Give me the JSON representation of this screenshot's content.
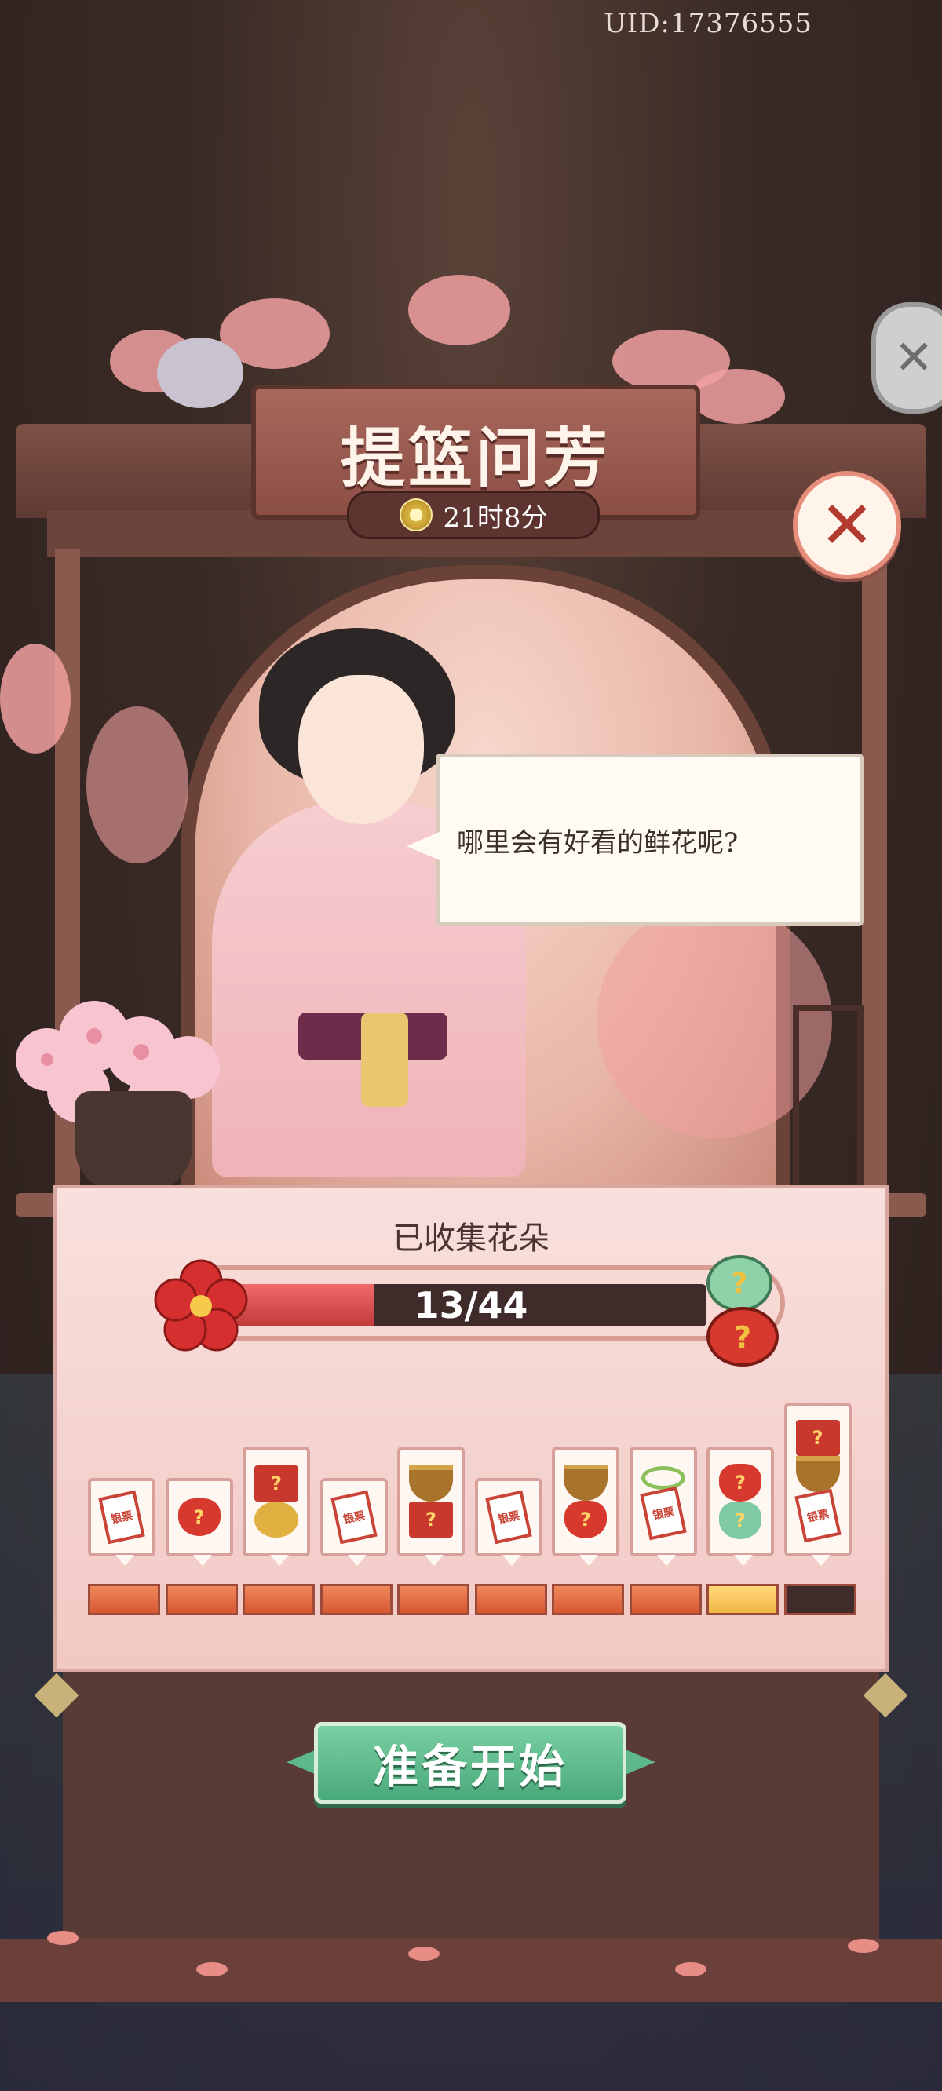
{
  "header": {
    "uid": "UID:17376555"
  },
  "event": {
    "title": "提篮问芳",
    "timer": "21时8分",
    "timer_icon": "clock-coin-icon",
    "close_icon": "close-icon"
  },
  "dialogue": {
    "text": "哪里会有好看的鲜花呢?"
  },
  "collection": {
    "title": "已收集花朵",
    "progress_text": "13/44",
    "current": 13,
    "total": 44,
    "fraction": 0.295,
    "flower_icon": "plum-blossom-icon",
    "reward_icon": "lucky-bag-icon"
  },
  "milestones": [
    {
      "items": [
        "silver-ticket-icon"
      ],
      "status": "done"
    },
    {
      "items": [
        "red-lucky-bag-icon"
      ],
      "status": "done"
    },
    {
      "items": [
        "red-gift-box-icon",
        "fortune-doll-icon"
      ],
      "status": "done"
    },
    {
      "items": [
        "silver-ticket-icon"
      ],
      "status": "done"
    },
    {
      "items": [
        "incense-burner-icon",
        "red-gift-box-icon"
      ],
      "status": "done"
    },
    {
      "items": [
        "silver-ticket-icon"
      ],
      "status": "done"
    },
    {
      "items": [
        "incense-burner-icon",
        "red-lucky-bag-icon"
      ],
      "status": "done"
    },
    {
      "items": [
        "scissors-icon",
        "silver-ticket-icon"
      ],
      "status": "done"
    },
    {
      "items": [
        "red-lucky-bag-icon",
        "green-lucky-bag-icon"
      ],
      "status": "current"
    },
    {
      "items": [
        "red-gift-box-icon",
        "incense-burner-icon",
        "silver-ticket-icon"
      ],
      "status": "locked"
    }
  ],
  "ticket_text": "银票",
  "unknown_mark": "?",
  "actions": {
    "start_label": "准备开始"
  },
  "colors": {
    "progress_fill": "#d84545",
    "start_button": "#5fbf8e",
    "panel": "#f4d2ce",
    "wood": "#6b443c"
  }
}
